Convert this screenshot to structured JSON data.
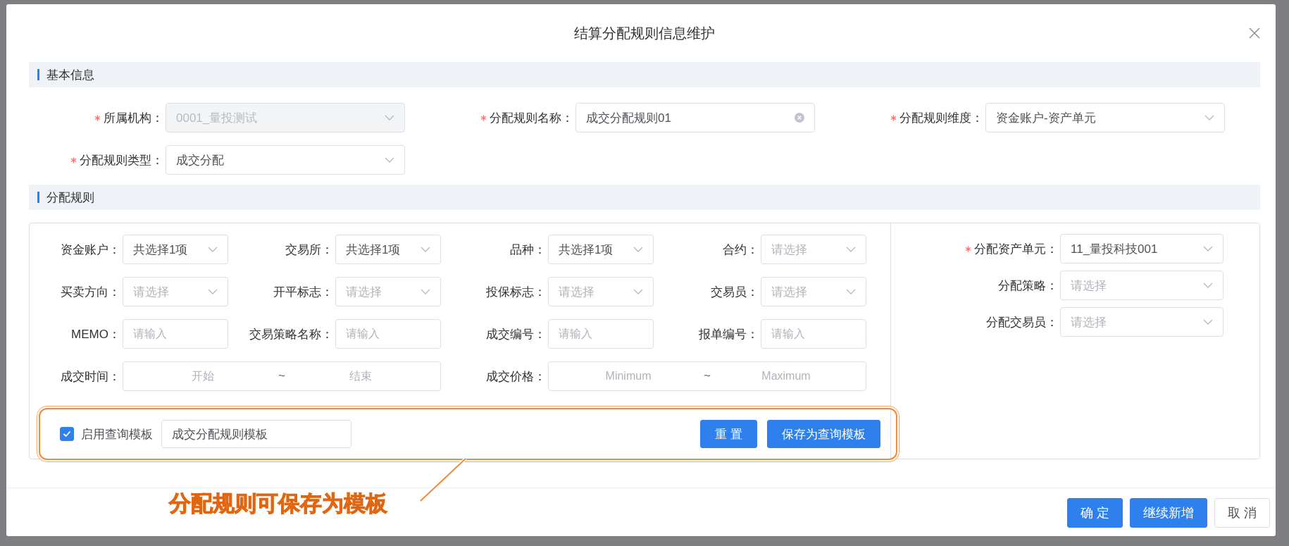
{
  "dialog": {
    "title": "结算分配规则信息维护"
  },
  "basic_info": {
    "title": "基本信息",
    "fields": [
      {
        "label": "所属机构：",
        "required": true,
        "kind": "select",
        "value": "0001_量投测试",
        "disabled": true
      },
      {
        "label": "分配规则名称：",
        "required": true,
        "kind": "input",
        "value": "成交分配规则01",
        "clearable": true
      },
      {
        "label": "分配规则维度：",
        "required": true,
        "kind": "select",
        "value": "资金账户-资产单元"
      },
      {
        "label": "分配规则类型：",
        "required": true,
        "kind": "select",
        "value": "成交分配"
      }
    ]
  },
  "rules": {
    "title": "分配规则",
    "filters": [
      {
        "label": "资金账户：",
        "kind": "select",
        "value": "共选择1项"
      },
      {
        "label": "交易所：",
        "kind": "select",
        "value": "共选择1项"
      },
      {
        "label": "品种：",
        "kind": "select",
        "value": "共选择1项"
      },
      {
        "label": "合约：",
        "kind": "select",
        "placeholder": "请选择"
      },
      {
        "label": "买卖方向：",
        "kind": "select",
        "placeholder": "请选择"
      },
      {
        "label": "开平标志：",
        "kind": "select",
        "placeholder": "请选择"
      },
      {
        "label": "投保标志：",
        "kind": "select",
        "placeholder": "请选择"
      },
      {
        "label": "交易员：",
        "kind": "select",
        "placeholder": "请选择"
      },
      {
        "label": "MEMO：",
        "kind": "input",
        "placeholder": "请输入"
      },
      {
        "label": "交易策略名称：",
        "kind": "input",
        "placeholder": "请输入"
      },
      {
        "label": "成交编号：",
        "kind": "input",
        "placeholder": "请输入"
      },
      {
        "label": "报单编号：",
        "kind": "input",
        "placeholder": "请输入"
      },
      {
        "label": "成交时间：",
        "kind": "range",
        "start_placeholder": "开始",
        "separator": "~",
        "end_placeholder": "结束"
      },
      {
        "label": "成交价格：",
        "kind": "range",
        "start_placeholder": "Minimum",
        "separator": "~",
        "end_placeholder": "Maximum"
      }
    ],
    "targets": [
      {
        "label": "分配资产单元：",
        "required": true,
        "kind": "select",
        "value": "11_量投科技001"
      },
      {
        "label": "分配策略：",
        "kind": "select",
        "placeholder": "请选择"
      },
      {
        "label": "分配交易员：",
        "kind": "select",
        "placeholder": "请选择"
      }
    ]
  },
  "template": {
    "checked": true,
    "label": "启用查询模板",
    "value": "成交分配规则模板",
    "buttons": [
      "重 置",
      "保存为查询模板"
    ]
  },
  "annotation": "分配规则可保存为模板",
  "footer_buttons": [
    {
      "label": "确 定",
      "primary": true
    },
    {
      "label": "继续新增",
      "primary": true
    },
    {
      "label": "取 消",
      "primary": false
    }
  ]
}
